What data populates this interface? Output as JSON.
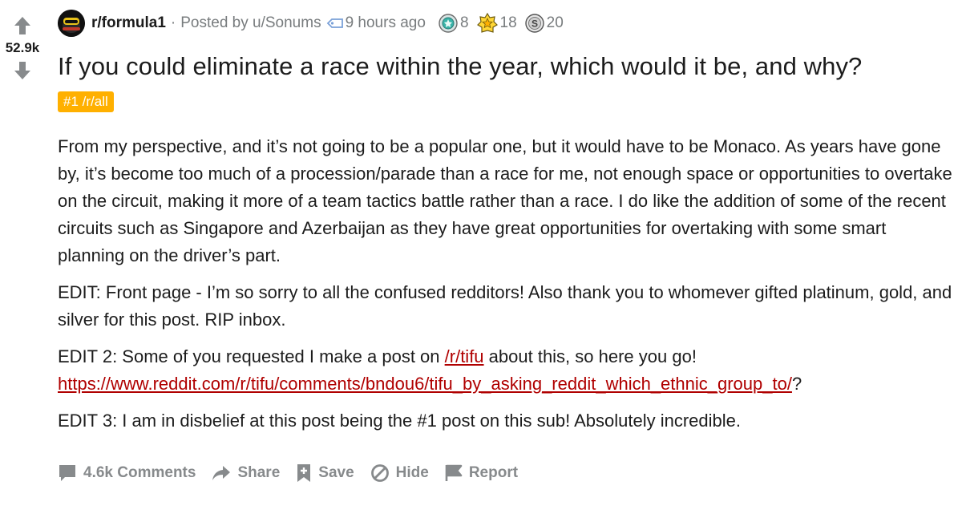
{
  "vote": {
    "score": "52.9k"
  },
  "meta": {
    "subreddit": "r/formula1",
    "separator": "·",
    "posted_by": "Posted by u/Sonums",
    "time": "9 hours ago",
    "awards": [
      {
        "name": "platinum",
        "count": "8"
      },
      {
        "name": "gold",
        "count": "18"
      },
      {
        "name": "silver",
        "count": "20"
      }
    ]
  },
  "post": {
    "title": "If you could eliminate a race within the year, which would it be, and why?",
    "flair": "#1 /r/all",
    "paragraphs": {
      "p1": "From my perspective, and it’s not going to be a popular one, but it would have to be Monaco. As years have gone by, it’s become too much of a procession/parade than a race for me, not enough space or opportunities to overtake on the circuit, making it more of a team tactics battle rather than a race. I do like the addition of some of the recent circuits such as Singapore and Azerbaijan as they have great opportunities for overtaking with some smart planning on the driver’s part.",
      "p2": "EDIT: Front page - I’m so sorry to all the confused redditors! Also thank you to whomever gifted platinum, gold, and silver for this post. RIP inbox.",
      "p3_before": "EDIT 2: Some of you requested I make a post on ",
      "p3_link1": "/r/tifu",
      "p3_middle": " about this, so here you go!",
      "p3_link2": "https://www.reddit.com/r/tifu/comments/bndou6/tifu_by_asking_reddit_which_ethnic_group_to/",
      "p3_after": "?",
      "p4": "EDIT 3: I am in disbelief at this post being the #1 post on this sub! Absolutely incredible."
    }
  },
  "actions": {
    "comments": "4.6k Comments",
    "share": "Share",
    "save": "Save",
    "hide": "Hide",
    "report": "Report"
  },
  "colors": {
    "flair_bg": "#ffb000",
    "link": "#b00000",
    "meta_gray": "#787c7e",
    "action_gray": "#878a8c"
  }
}
